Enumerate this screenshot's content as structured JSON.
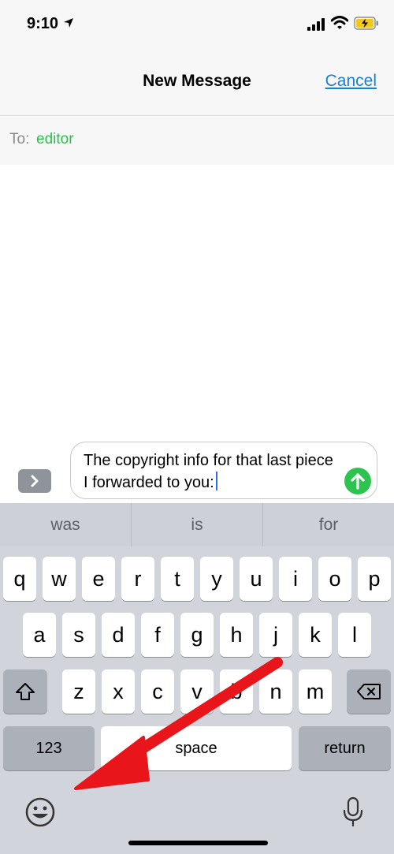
{
  "status_bar": {
    "time": "9:10",
    "icons": [
      "location-arrow-icon",
      "signal-bars-icon",
      "wifi-icon",
      "battery-charging-icon"
    ]
  },
  "nav": {
    "title": "New Message",
    "cancel_label": "Cancel"
  },
  "recipient": {
    "to_label": "To:",
    "to_value": "editor"
  },
  "composer": {
    "message_text": "The copyright info for that last piece I forwarded to you:",
    "app_drawer_icon": "chevron-right-icon",
    "send_icon": "arrow-up-icon"
  },
  "keyboard": {
    "suggestions": [
      "was",
      "is",
      "for"
    ],
    "row1": [
      "q",
      "w",
      "e",
      "r",
      "t",
      "y",
      "u",
      "i",
      "o",
      "p"
    ],
    "row2": [
      "a",
      "s",
      "d",
      "f",
      "g",
      "h",
      "j",
      "k",
      "l"
    ],
    "row3": [
      "z",
      "x",
      "c",
      "v",
      "b",
      "n",
      "m"
    ],
    "numbers_label": "123",
    "space_label": "space",
    "return_label": "return",
    "shift_icon": "shift-arrow-icon",
    "delete_icon": "backspace-icon",
    "emoji_icon": "emoji-smiley-icon",
    "mic_icon": "microphone-icon"
  },
  "colors": {
    "link_blue": "#1a7fd8",
    "recipient_green": "#2cbf4a",
    "send_green": "#2cc44e",
    "annotation_red": "#e8161b"
  }
}
